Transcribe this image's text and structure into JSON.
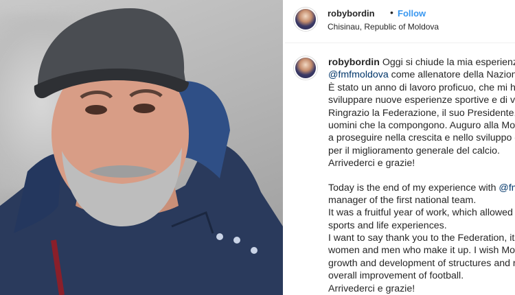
{
  "post": {
    "username": "robybordin",
    "separator": "•",
    "follow_label": "Follow",
    "location": "Chisinau, Republic of Moldova"
  },
  "caption": {
    "username": "robybordin",
    "lines_it": [
      " Oggi si chiude la mia esperienza",
      "@fmfmoldova come allenatore della Naziona",
      "È stato un anno di lavoro proficuo, che mi ha",
      "sviluppare nuove esperienze sportive e di vita",
      "Ringrazio la Federazione, il suo Presidente, tu",
      "uomini che la compongono. Auguro alla Mold",
      "a proseguire nella crescita e nello sviluppo di",
      "per il miglioramento generale del calcio.",
      "Arrivederci e grazie!"
    ],
    "lines_en": [
      "Today is the end of my experience with ",
      "manager of the first national team.",
      "It was a fruitful year of work, which allowed m",
      "sports and life experiences.",
      "I want to say thank you to the Federation, its",
      "women and men who make it up. I wish Mold",
      "growth and development of structures and re",
      "overall improvement of football.",
      "Arrivederci e grazie!"
    ],
    "mention_it": "@fmfmoldova",
    "mention_en": "@fmf"
  },
  "colors": {
    "follow": "#3897f0",
    "mention": "#003569",
    "text": "#262626"
  }
}
